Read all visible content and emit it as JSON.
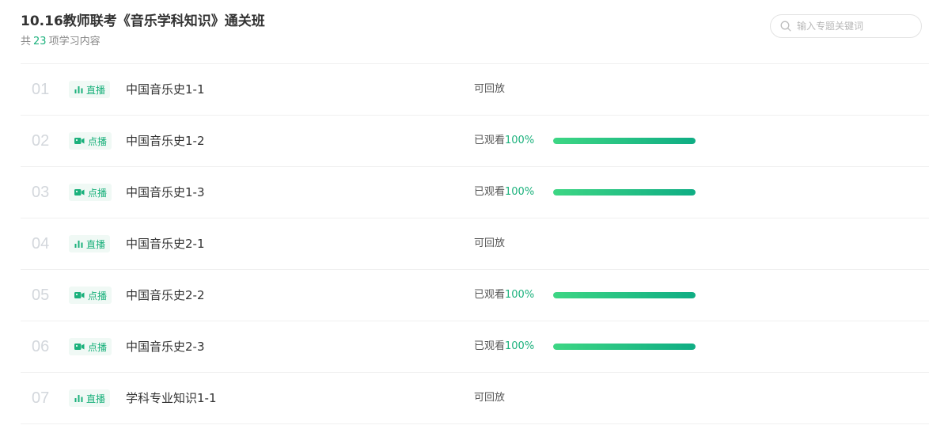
{
  "header": {
    "title": "10.16教师联考《音乐学科知识》通关班",
    "subtitle_prefix": "共",
    "item_count": "23",
    "subtitle_suffix": "项学习内容"
  },
  "search": {
    "placeholder": "输入专题关键词",
    "icon": "search-icon"
  },
  "colors": {
    "accent": "#1bb17c",
    "progress_start": "#3dd684",
    "progress_end": "#0fad84"
  },
  "items": [
    {
      "index": "01",
      "type": "live",
      "type_label": "直播",
      "type_icon": "live-bars-icon",
      "title": "中国音乐史1-1",
      "status": "可回放"
    },
    {
      "index": "02",
      "type": "vod",
      "type_label": "点播",
      "type_icon": "video-camera-icon",
      "title": "中国音乐史1-2",
      "status_prefix": "已观看",
      "progress_label": "100%",
      "progress": 1.0
    },
    {
      "index": "03",
      "type": "vod",
      "type_label": "点播",
      "type_icon": "video-camera-icon",
      "title": "中国音乐史1-3",
      "status_prefix": "已观看",
      "progress_label": "100%",
      "progress": 1.0
    },
    {
      "index": "04",
      "type": "live",
      "type_label": "直播",
      "type_icon": "live-bars-icon",
      "title": "中国音乐史2-1",
      "status": "可回放"
    },
    {
      "index": "05",
      "type": "vod",
      "type_label": "点播",
      "type_icon": "video-camera-icon",
      "title": "中国音乐史2-2",
      "status_prefix": "已观看",
      "progress_label": "100%",
      "progress": 1.0
    },
    {
      "index": "06",
      "type": "vod",
      "type_label": "点播",
      "type_icon": "video-camera-icon",
      "title": "中国音乐史2-3",
      "status_prefix": "已观看",
      "progress_label": "100%",
      "progress": 1.0
    },
    {
      "index": "07",
      "type": "live",
      "type_label": "直播",
      "type_icon": "live-bars-icon",
      "title": "学科专业知识1-1",
      "status": "可回放"
    }
  ]
}
